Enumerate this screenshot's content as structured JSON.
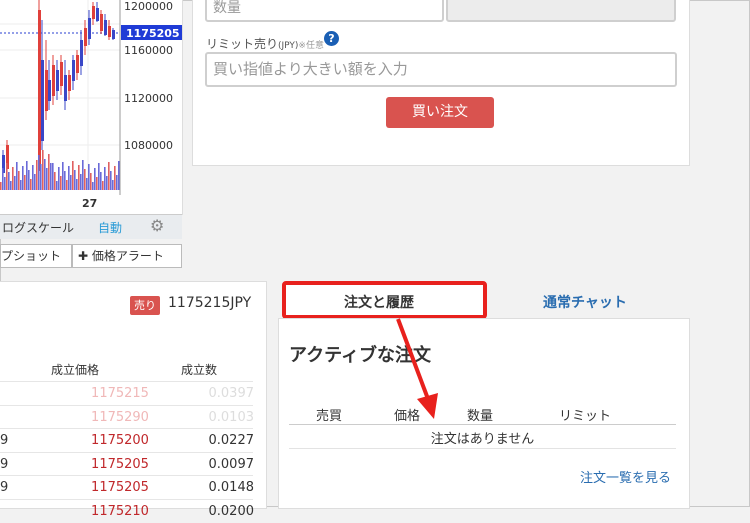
{
  "chart": {
    "y_ticks": [
      "1200000",
      "1160000",
      "1120000",
      "1080000"
    ],
    "current_price": "1175205",
    "date_label": "27",
    "log_scale_label": "ログスケール",
    "auto_label": "自動",
    "settings_icon": "gear-icon",
    "snapshot_label": "プショット",
    "price_alert_label": "価格アラート"
  },
  "order_form": {
    "quantity_placeholder": "数量",
    "limit_label": "リミット売り",
    "limit_unit": "(JPY)",
    "limit_optional": "※任意",
    "help_icon": "?",
    "limit_placeholder": "買い指値より大きい額を入力",
    "buy_button": "買い注文"
  },
  "trades": {
    "side_badge": "売り",
    "last_price": "1175215JPY",
    "col_price": "成立価格",
    "col_amount": "成立数",
    "rows": [
      {
        "prefix": "",
        "price": "1175215",
        "amount": "0.0397",
        "faded": true
      },
      {
        "prefix": "",
        "price": "1175290",
        "amount": "0.0103",
        "faded": true
      },
      {
        "prefix": "9",
        "price": "1175200",
        "amount": "0.0227",
        "faded": false
      },
      {
        "prefix": "9",
        "price": "1175205",
        "amount": "0.0097",
        "faded": false
      },
      {
        "prefix": "9",
        "price": "1175205",
        "amount": "0.0148",
        "faded": false
      },
      {
        "prefix": "",
        "price": "1175210",
        "amount": "0.0200",
        "faded": false
      }
    ]
  },
  "tabs": {
    "orders": "注文と履歴",
    "chart": "通常チャット"
  },
  "orders": {
    "title": "アクティブな注文",
    "col_side": "売買",
    "col_price": "価格",
    "col_qty": "数量",
    "col_limit": "リミット",
    "empty": "注文はありません",
    "view_all": "注文一覧を見る"
  },
  "colors": {
    "sell_red": "#d9534f",
    "highlight_red": "#e8211d",
    "link_blue": "#2a6db0",
    "price_red": "#c0282b",
    "price_faded": "#f0b8b8"
  }
}
